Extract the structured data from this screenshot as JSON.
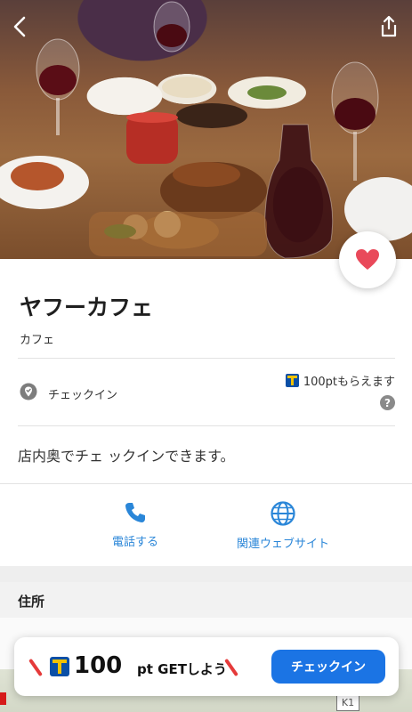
{
  "hero": {
    "photo_subject": "restaurant-table-photo"
  },
  "shop": {
    "name": "ヤフーカフェ",
    "category": "カフェ"
  },
  "checkin": {
    "label": "チェックイン",
    "points_text": "100ptもらえます",
    "help_symbol": "?"
  },
  "note": "店内奥でチェ ックインできます。",
  "actions": [
    {
      "label": "電話する",
      "icon": "phone-icon"
    },
    {
      "label": "関連ウェブサイト",
      "icon": "globe-icon"
    }
  ],
  "address_section": {
    "title": "住所"
  },
  "map": {
    "label": "K1"
  },
  "promo_banner": {
    "amount": "100",
    "rest": "pt GETしよう",
    "button_label": "チェックイン"
  },
  "colors": {
    "accent": "#1b74e4",
    "link": "#2a86d8",
    "heart": "#e9495a",
    "tpoint_blue": "#0a4fa6",
    "tpoint_yellow": "#f2c200",
    "promo_slash": "#e53a3a"
  }
}
